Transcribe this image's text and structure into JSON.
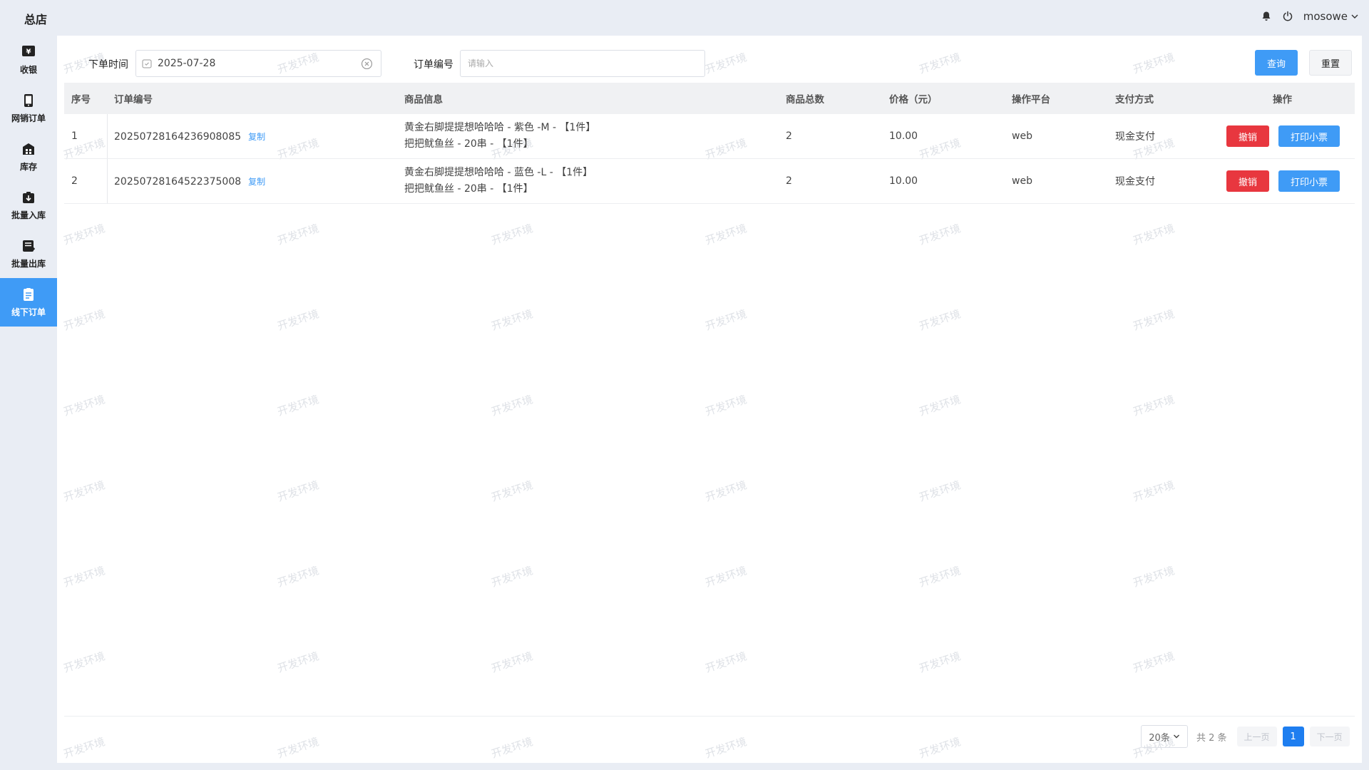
{
  "header": {
    "store_name": "总店",
    "username": "mosowe"
  },
  "sidebar": {
    "items": [
      {
        "label": "收银",
        "icon": "cashier-icon"
      },
      {
        "label": "网销订单",
        "icon": "phone-icon"
      },
      {
        "label": "库存",
        "icon": "warehouse-icon"
      },
      {
        "label": "批量入库",
        "icon": "box-in-icon"
      },
      {
        "label": "批量出库",
        "icon": "box-out-icon"
      },
      {
        "label": "线下订单",
        "icon": "clipboard-icon",
        "active": true
      }
    ]
  },
  "filters": {
    "date_label": "下单时间",
    "date_value": "2025-07-28",
    "order_label": "订单编号",
    "order_placeholder": "请输入",
    "query_label": "查询",
    "reset_label": "重置"
  },
  "table": {
    "columns": [
      "序号",
      "订单编号",
      "商品信息",
      "商品总数",
      "价格（元）",
      "操作平台",
      "支付方式",
      "操作"
    ],
    "rows": [
      {
        "index": "1",
        "order_no": "20250728164236908085",
        "copy": "复制",
        "goods_line1": "黄金右脚提提想哈哈哈 - 紫色 -M - 【1件】",
        "goods_line2": "把把鱿鱼丝 - 20串 - 【1件】",
        "total": "2",
        "price": "10.00",
        "platform": "web",
        "payment": "现金支付",
        "cancel": "撤销",
        "print": "打印小票"
      },
      {
        "index": "2",
        "order_no": "20250728164522375008",
        "copy": "复制",
        "goods_line1": "黄金右脚提提想哈哈哈 - 蓝色 -L - 【1件】",
        "goods_line2": "把把鱿鱼丝 - 20串 - 【1件】",
        "total": "2",
        "price": "10.00",
        "platform": "web",
        "payment": "现金支付",
        "cancel": "撤销",
        "print": "打印小票"
      }
    ]
  },
  "pagination": {
    "page_size": "20条",
    "total_text": "共 2 条",
    "prev": "上一页",
    "current": "1",
    "next": "下一页"
  },
  "watermark": "开发环境",
  "colors": {
    "primary": "#3f9bf6",
    "danger": "#e8373f",
    "page_bg": "#e9edf4"
  }
}
